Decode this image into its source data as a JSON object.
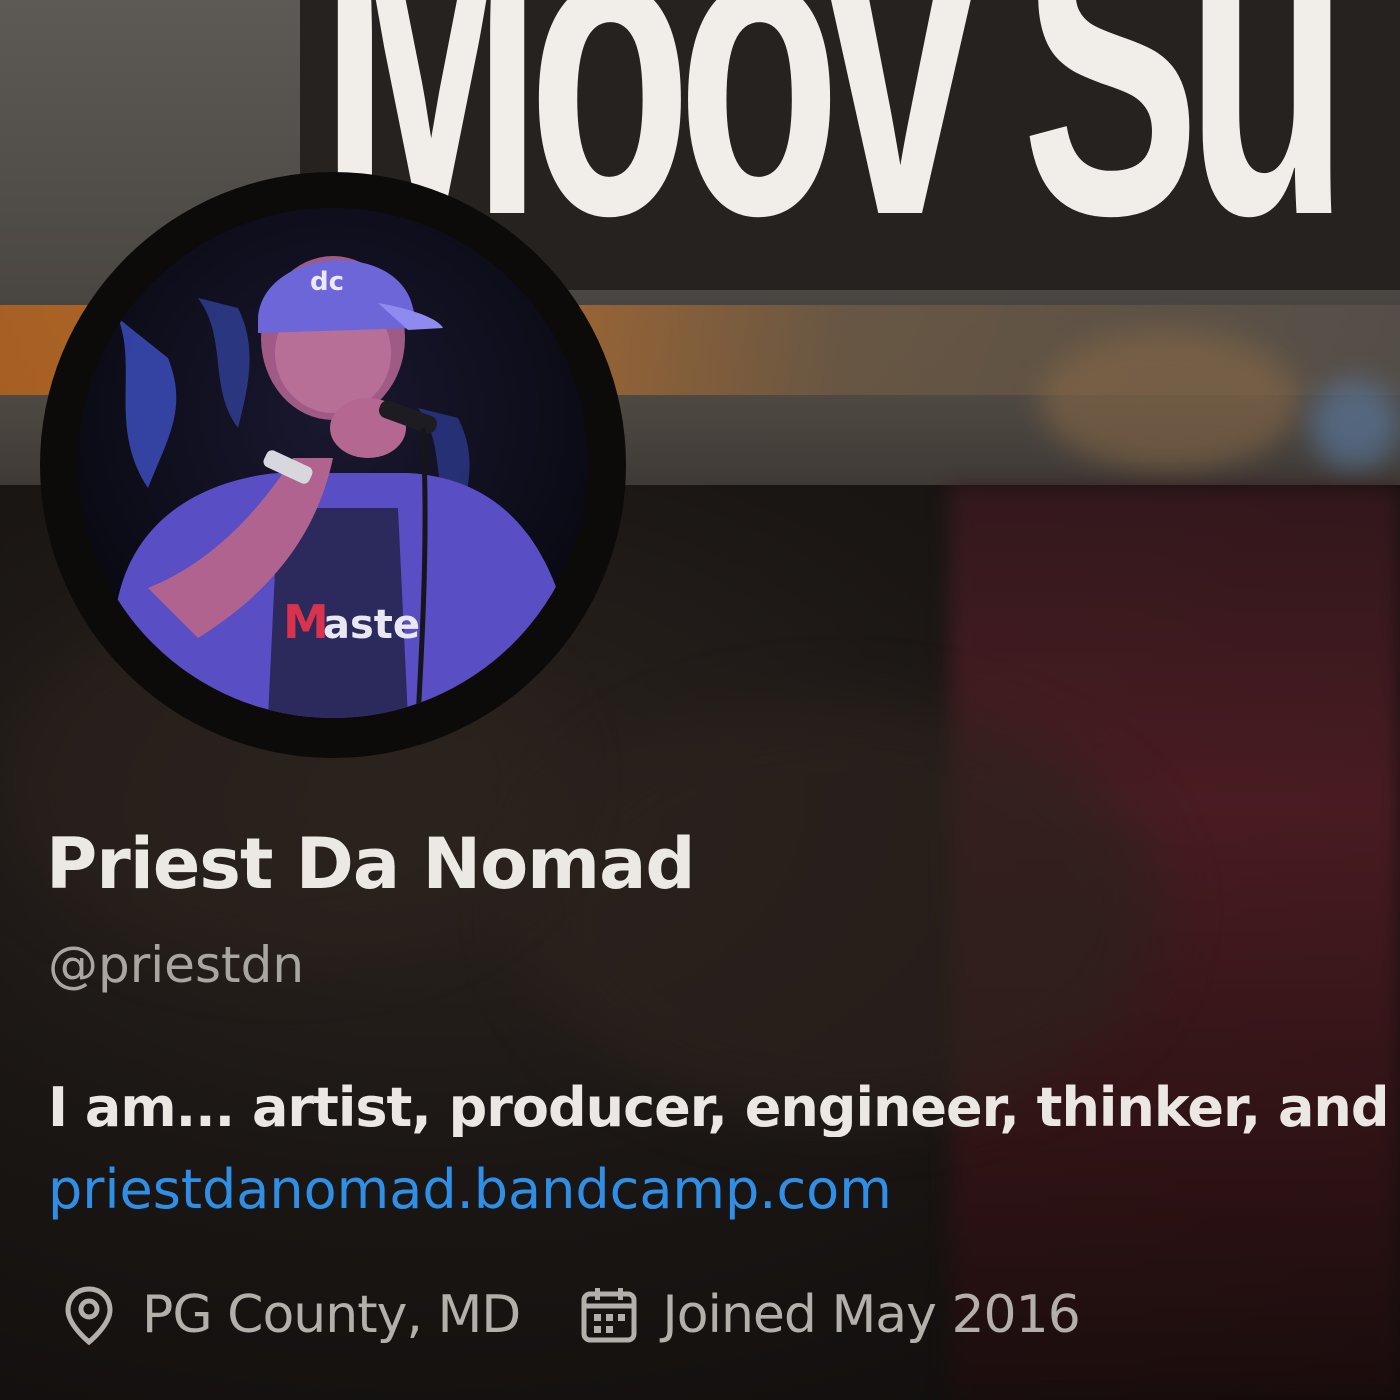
{
  "banner": {
    "text": "Moov Su"
  },
  "profile": {
    "display_name": "Priest Da Nomad",
    "handle": "@priestdn",
    "bio": "I am... artist, producer, engineer, thinker, and una",
    "website": "priestdanomad.bandcamp.com",
    "location": "PG County, MD",
    "joined": "Joined May 2016"
  },
  "icons": {
    "location": "map-pin-icon",
    "joined": "calendar-icon"
  },
  "colors": {
    "link": "#2f8fe6",
    "name": "#ece8e3",
    "secondary_text": "#b3afab"
  }
}
